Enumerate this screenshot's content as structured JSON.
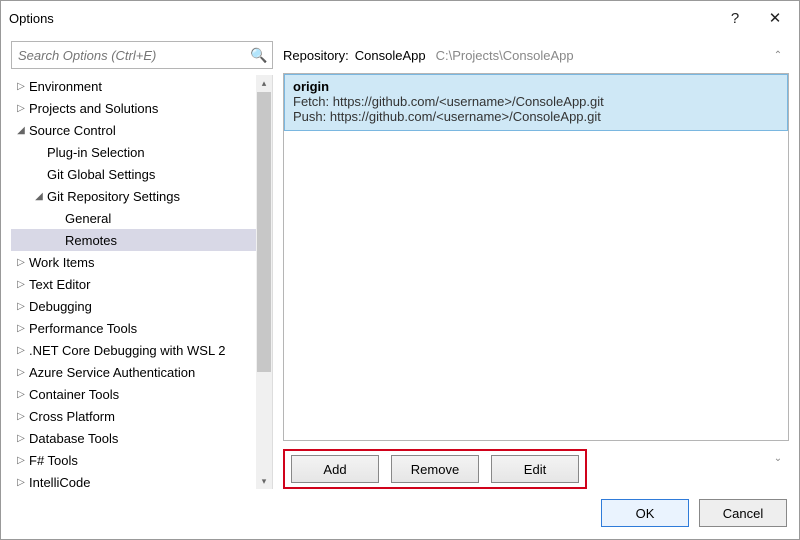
{
  "window": {
    "title": "Options",
    "help": "?",
    "close": "✕"
  },
  "search": {
    "placeholder": "Search Options (Ctrl+E)"
  },
  "tree": {
    "items": [
      {
        "label": "Environment",
        "depth": 0,
        "arrow": "▷"
      },
      {
        "label": "Projects and Solutions",
        "depth": 0,
        "arrow": "▷"
      },
      {
        "label": "Source Control",
        "depth": 0,
        "arrow": "◢"
      },
      {
        "label": "Plug-in Selection",
        "depth": 1,
        "arrow": ""
      },
      {
        "label": "Git Global Settings",
        "depth": 1,
        "arrow": ""
      },
      {
        "label": "Git Repository Settings",
        "depth": 1,
        "arrow": "◢"
      },
      {
        "label": "General",
        "depth": 2,
        "arrow": ""
      },
      {
        "label": "Remotes",
        "depth": 2,
        "arrow": "",
        "selected": true
      },
      {
        "label": "Work Items",
        "depth": 0,
        "arrow": "▷"
      },
      {
        "label": "Text Editor",
        "depth": 0,
        "arrow": "▷"
      },
      {
        "label": "Debugging",
        "depth": 0,
        "arrow": "▷"
      },
      {
        "label": "Performance Tools",
        "depth": 0,
        "arrow": "▷"
      },
      {
        "label": ".NET Core Debugging with WSL 2",
        "depth": 0,
        "arrow": "▷"
      },
      {
        "label": "Azure Service Authentication",
        "depth": 0,
        "arrow": "▷"
      },
      {
        "label": "Container Tools",
        "depth": 0,
        "arrow": "▷"
      },
      {
        "label": "Cross Platform",
        "depth": 0,
        "arrow": "▷"
      },
      {
        "label": "Database Tools",
        "depth": 0,
        "arrow": "▷"
      },
      {
        "label": "F# Tools",
        "depth": 0,
        "arrow": "▷"
      },
      {
        "label": "IntelliCode",
        "depth": 0,
        "arrow": "▷"
      }
    ]
  },
  "right": {
    "repo_label": "Repository:",
    "repo_name": "ConsoleApp",
    "repo_path": "C:\\Projects\\ConsoleApp",
    "remote": {
      "name": "origin",
      "fetch_label": "Fetch:",
      "fetch_url": "https://github.com/<username>/ConsoleApp.git",
      "push_label": "Push:",
      "push_url": "https://github.com/<username>/ConsoleApp.git"
    },
    "buttons": {
      "add": "Add",
      "remove": "Remove",
      "edit": "Edit"
    }
  },
  "footer": {
    "ok": "OK",
    "cancel": "Cancel"
  }
}
